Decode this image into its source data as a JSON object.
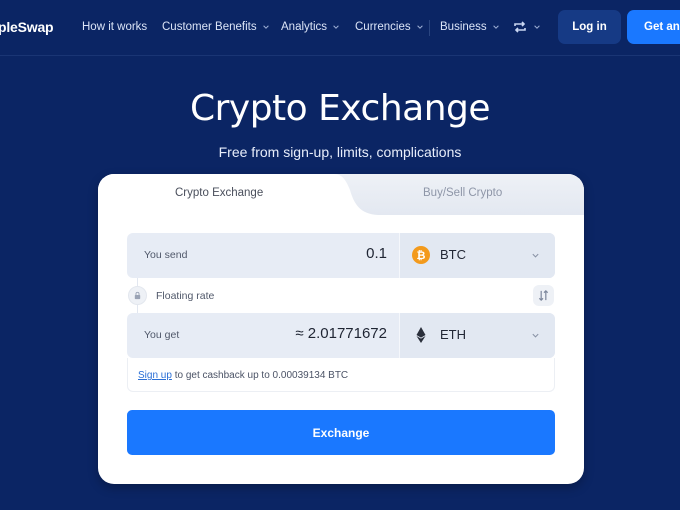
{
  "nav": {
    "logo": "SimpleSwap",
    "logo_visible": "pleSwap",
    "items": [
      {
        "label": "How it works",
        "has_dropdown": false
      },
      {
        "label": "Customer Benefits",
        "has_dropdown": true
      },
      {
        "label": "Analytics",
        "has_dropdown": true
      },
      {
        "label": "Currencies",
        "has_dropdown": true
      },
      {
        "label": "Business",
        "has_dropdown": true
      }
    ],
    "swap_icon": "swap-arrows-icon",
    "login_label": "Log in",
    "cta_label": "Get an account"
  },
  "hero": {
    "title": "Crypto Exchange",
    "subtitle": "Free from sign-up, limits, complications"
  },
  "widget": {
    "tabs": [
      {
        "label": "Crypto Exchange",
        "active": true
      },
      {
        "label": "Buy/Sell Crypto",
        "active": false
      }
    ],
    "send": {
      "label": "You send",
      "amount": "0.1",
      "currency": "BTC",
      "currency_icon": "bitcoin-icon",
      "currency_color": "#f39a1c"
    },
    "rate": {
      "label": "Floating rate",
      "lock_icon": "lock-icon",
      "swap_icon": "swap-direction-icon"
    },
    "get": {
      "label": "You get",
      "amount": "≈ 2.01771672",
      "currency": "ETH",
      "currency_icon": "ethereum-icon"
    },
    "cashback": {
      "link": "Sign up",
      "text": " to get cashback up to 0.00039134 BTC"
    },
    "submit_label": "Exchange"
  },
  "colors": {
    "background": "#0b2564",
    "accent": "#1a78ff",
    "login_bg": "#163a85"
  }
}
